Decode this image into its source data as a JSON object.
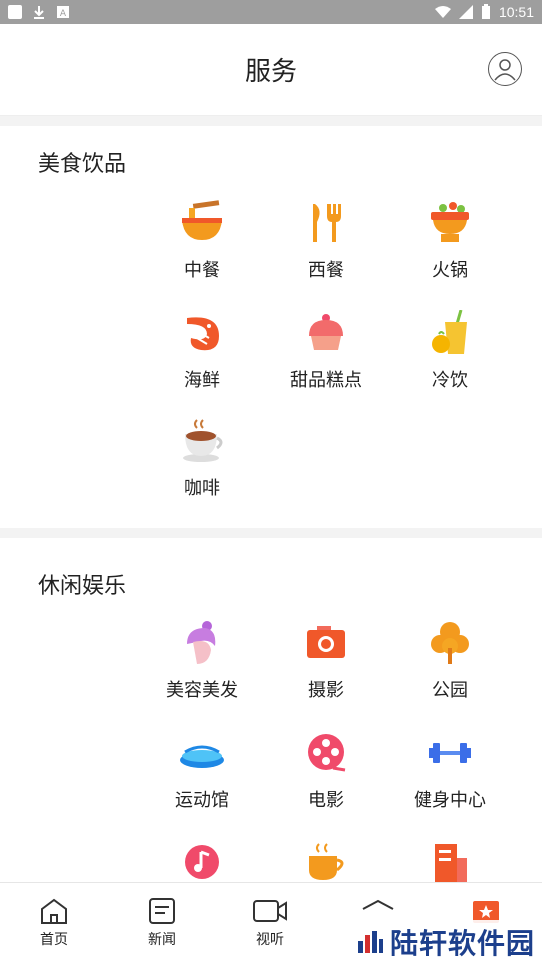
{
  "status_bar": {
    "time": "10:51"
  },
  "header": {
    "title": "服务"
  },
  "sections": [
    {
      "heading": "美食饮品",
      "items": [
        {
          "label": "中餐",
          "icon": "noodle-bowl-icon"
        },
        {
          "label": "西餐",
          "icon": "fork-knife-icon"
        },
        {
          "label": "火锅",
          "icon": "hotpot-icon"
        },
        {
          "label": "海鲜",
          "icon": "shrimp-icon"
        },
        {
          "label": "甜品糕点",
          "icon": "cupcake-icon"
        },
        {
          "label": "冷饮",
          "icon": "cold-drink-icon"
        },
        {
          "label": "咖啡",
          "icon": "coffee-cup-icon"
        }
      ]
    },
    {
      "heading": "休闲娱乐",
      "items": [
        {
          "label": "美容美发",
          "icon": "beauty-icon"
        },
        {
          "label": "摄影",
          "icon": "camera-icon"
        },
        {
          "label": "公园",
          "icon": "tree-icon"
        },
        {
          "label": "运动馆",
          "icon": "stadium-icon"
        },
        {
          "label": "电影",
          "icon": "film-reel-icon"
        },
        {
          "label": "健身中心",
          "icon": "dumbbell-icon"
        }
      ]
    }
  ],
  "tabbar": {
    "tabs": [
      {
        "label": "首页",
        "icon": "home-icon"
      },
      {
        "label": "新闻",
        "icon": "news-icon"
      },
      {
        "label": "视听",
        "icon": "video-icon"
      },
      {
        "label": "",
        "icon": "building-icon"
      },
      {
        "label": "",
        "icon": "service-icon"
      }
    ]
  },
  "watermark": {
    "text": "陆轩软件园"
  },
  "colors": {
    "accent": "#f0582a",
    "orange": "#f39a1e",
    "pink": "#f04a6a",
    "blue": "#3b6ee8"
  }
}
